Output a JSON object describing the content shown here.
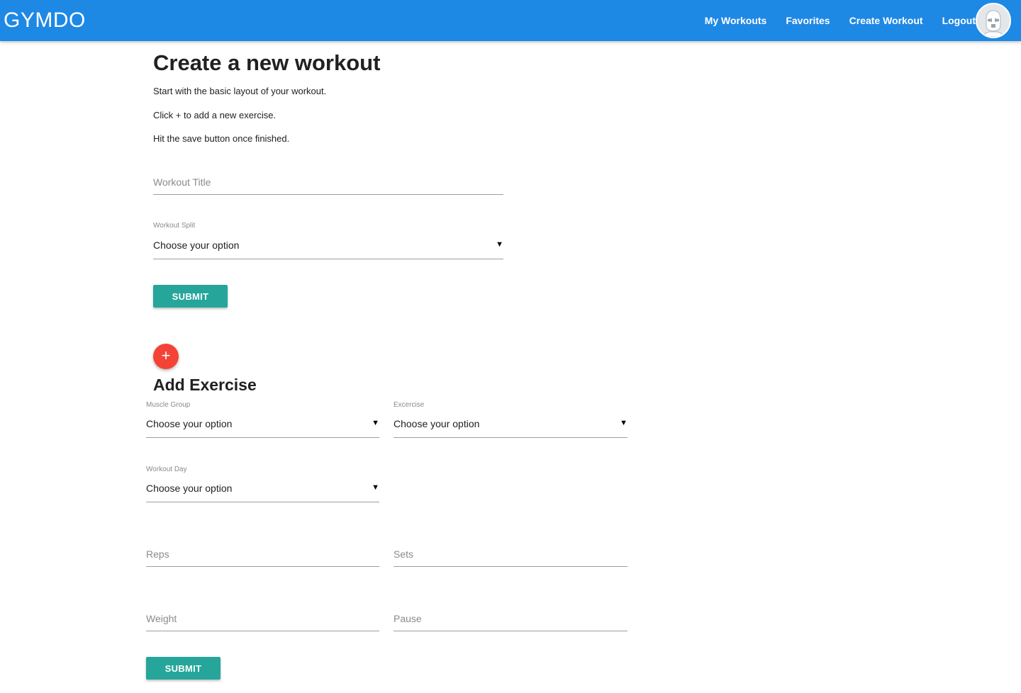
{
  "navbar": {
    "brand": "GYMDO",
    "links": [
      "My Workouts",
      "Favorites",
      "Create Workout",
      "Logout"
    ],
    "avatar_icon": "stormtrooper-avatar",
    "color": "#1e88e5"
  },
  "header": {
    "title": "Create a new workout",
    "instructions": [
      "Start with the basic layout of your workout.",
      "Click + to add a new exercise.",
      "Hit the save button once finished."
    ]
  },
  "workout_form": {
    "title_placeholder": "Workout Title",
    "split_label": "Workout Split",
    "split_value": "Choose your option",
    "submit_label": "SUBMIT"
  },
  "exercise_form": {
    "add_icon": "plus-icon",
    "add_symbol": "+",
    "title": "Add Exercise",
    "muscle_group_label": "Muscle Group",
    "muscle_group_value": "Choose your option",
    "exercise_label": "Excercise",
    "exercise_value": "Choose your option",
    "workout_day_label": "Workout Day",
    "workout_day_value": "Choose your option",
    "reps_placeholder": "Reps",
    "sets_placeholder": "Sets",
    "weight_placeholder": "Weight",
    "pause_placeholder": "Pause",
    "submit_label": "SUBMIT"
  },
  "colors": {
    "primary": "#1e88e5",
    "button": "#26a69a",
    "fab": "#f44336"
  }
}
